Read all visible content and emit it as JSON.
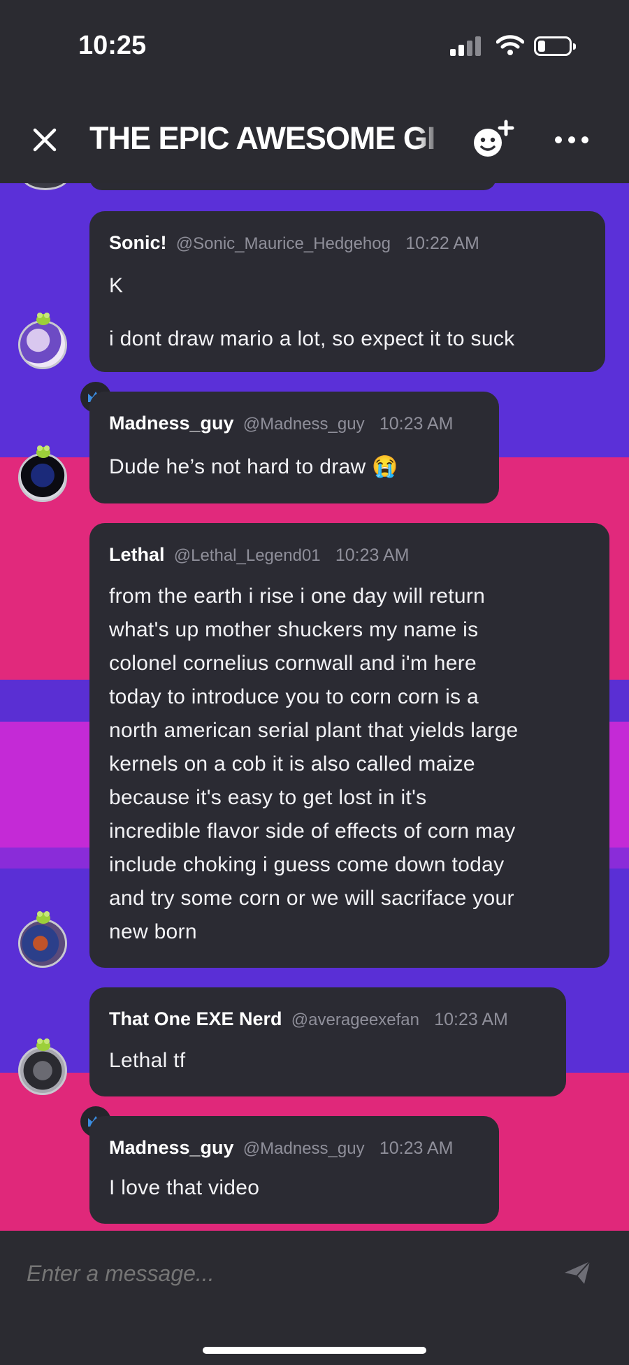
{
  "status": {
    "time": "10:25"
  },
  "header": {
    "title": "THE EPIC AWESOME GI"
  },
  "messages": [
    {
      "author": "Sonic!",
      "handle": "@Sonic_Maurice_Hedgehog",
      "time": "10:22 AM",
      "lines": [
        "K",
        "i dont draw mario a lot, so expect it to suck"
      ]
    },
    {
      "author": "Madness_guy",
      "handle": "@Madness_guy",
      "time": "10:23 AM",
      "lines": [
        "Dude he’s not hard to draw 😭"
      ]
    },
    {
      "author": "Lethal",
      "handle": "@Lethal_Legend01",
      "time": "10:23 AM",
      "lines": [
        "from the earth i rise i one day will return",
        "what's up mother shuckers my name is",
        "colonel cornelius cornwall and i'm here",
        "today to introduce you to corn corn is a",
        "north american serial plant that yields large",
        "kernels on a cob it is also called maize",
        "because it's easy to get lost in it's",
        "incredible flavor side of effects of corn may",
        "include choking i guess come down today",
        "and try some corn or we will sacriface your",
        "new born"
      ]
    },
    {
      "author": "That One EXE Nerd",
      "handle": "@averageexefan",
      "time": "10:23 AM",
      "lines": [
        "Lethal tf"
      ]
    },
    {
      "author": "Madness_guy",
      "handle": "@Madness_guy",
      "time": "10:23 AM",
      "lines": [
        "I love that video"
      ]
    }
  ],
  "composer": {
    "placeholder": "Enter a message..."
  },
  "colors": {
    "stripe_blue": "#5a2fd6",
    "stripe_pink": "#e0287a",
    "stripe_magenta": "#c42ad6",
    "bubble": "#2b2b33",
    "bar": "#2b2b31",
    "crown": "#3b8de0"
  },
  "icons": [
    "close-icon",
    "add-member-icon",
    "more-icon",
    "crown-icon",
    "send-icon"
  ]
}
